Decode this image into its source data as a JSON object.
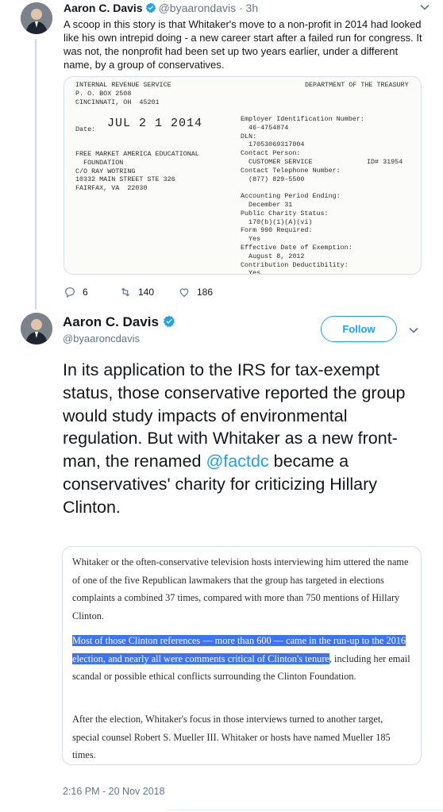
{
  "reply_tweet": {
    "author_name": "Aaron C. Davis",
    "author_handle": "@byaarondavis",
    "time_ago": "3h",
    "time_sep": "·",
    "text": "A scoop in this story is that Whitaker's move to a non-profit in 2014 had looked like his own intrepid doing - a new career start after a failed run for congress. It was not, the nonprofit had been set up two years earlier, under a different name, by a group of conservatives.",
    "image_doc": {
      "sender": "INTERNAL REVENUE SERVICE\nP. O. BOX 2508\nCINCINNATI, OH  45201",
      "department": "DEPARTMENT OF THE TREASURY",
      "date_label": "Date:",
      "date_value": "JUL 2 1 2014",
      "recipient": "FREE MARKET AMERICA EDUCATIONAL\n  FOUNDATION\nC/O RAY WOTRING\n10332 MAIN STREET STE 326\nFAIRFAX, VA  22030",
      "details": "Employer Identification Number:\n  46-4754874\nDLN:\n  17053069317004\nContact Person:\n  CUSTOMER SERVICE\nContact Telephone Number:\n  (877) 829-5500\n\nAccounting Period Ending:\n  December 31\nPublic Charity Status:\n  170(b)(1)(A)(vi)\nForm 990 Required:\n  Yes\nEffective Date of Exemption:\n  August 8, 2012\nContribution Deductibility:\n  Yes",
      "id_number": "ID# 31954"
    },
    "stats": {
      "replies": "6",
      "retweets": "140",
      "likes": "186"
    }
  },
  "main_tweet": {
    "author_name": "Aaron C. Davis",
    "author_handle": "@byaaroncdavis",
    "follow_label": "Follow",
    "text_before": "In its application to the IRS for tax-exempt status, those conservative reported  the group would study impacts of environmental regulation. But with Whitaker as a new front-man, the renamed ",
    "mention": "@factdc",
    "text_after": " became a conservatives' charity for criticizing Hillary Clinton.",
    "quote": {
      "para1": "Whitaker or the often-conservative television hosts interviewing him uttered the name of one of the five Republican lawmakers that the group has targeted in elections complaints a combined 37 times, compared with more than 750 mentions of Hillary Clinton.",
      "para2_highlighted": "Most of those Clinton references — more than 600 — came in the run-up to the 2016 election, and nearly all were comments critical of Clinton's tenure",
      "para2_rest": ", including her email scandal or possible ethical conflicts surrounding the Clinton Foundation.",
      "para3": "After the election, Whitaker's focus in those interviews turned to another target, special counsel Robert S. Mueller III. Whitaker or hosts have named Mueller 185 times."
    },
    "timestamp": "2:16 PM - 20 Nov 2018"
  },
  "colors": {
    "accent": "#1da1f2",
    "muted": "#657786",
    "highlight": "#3d73f5"
  }
}
